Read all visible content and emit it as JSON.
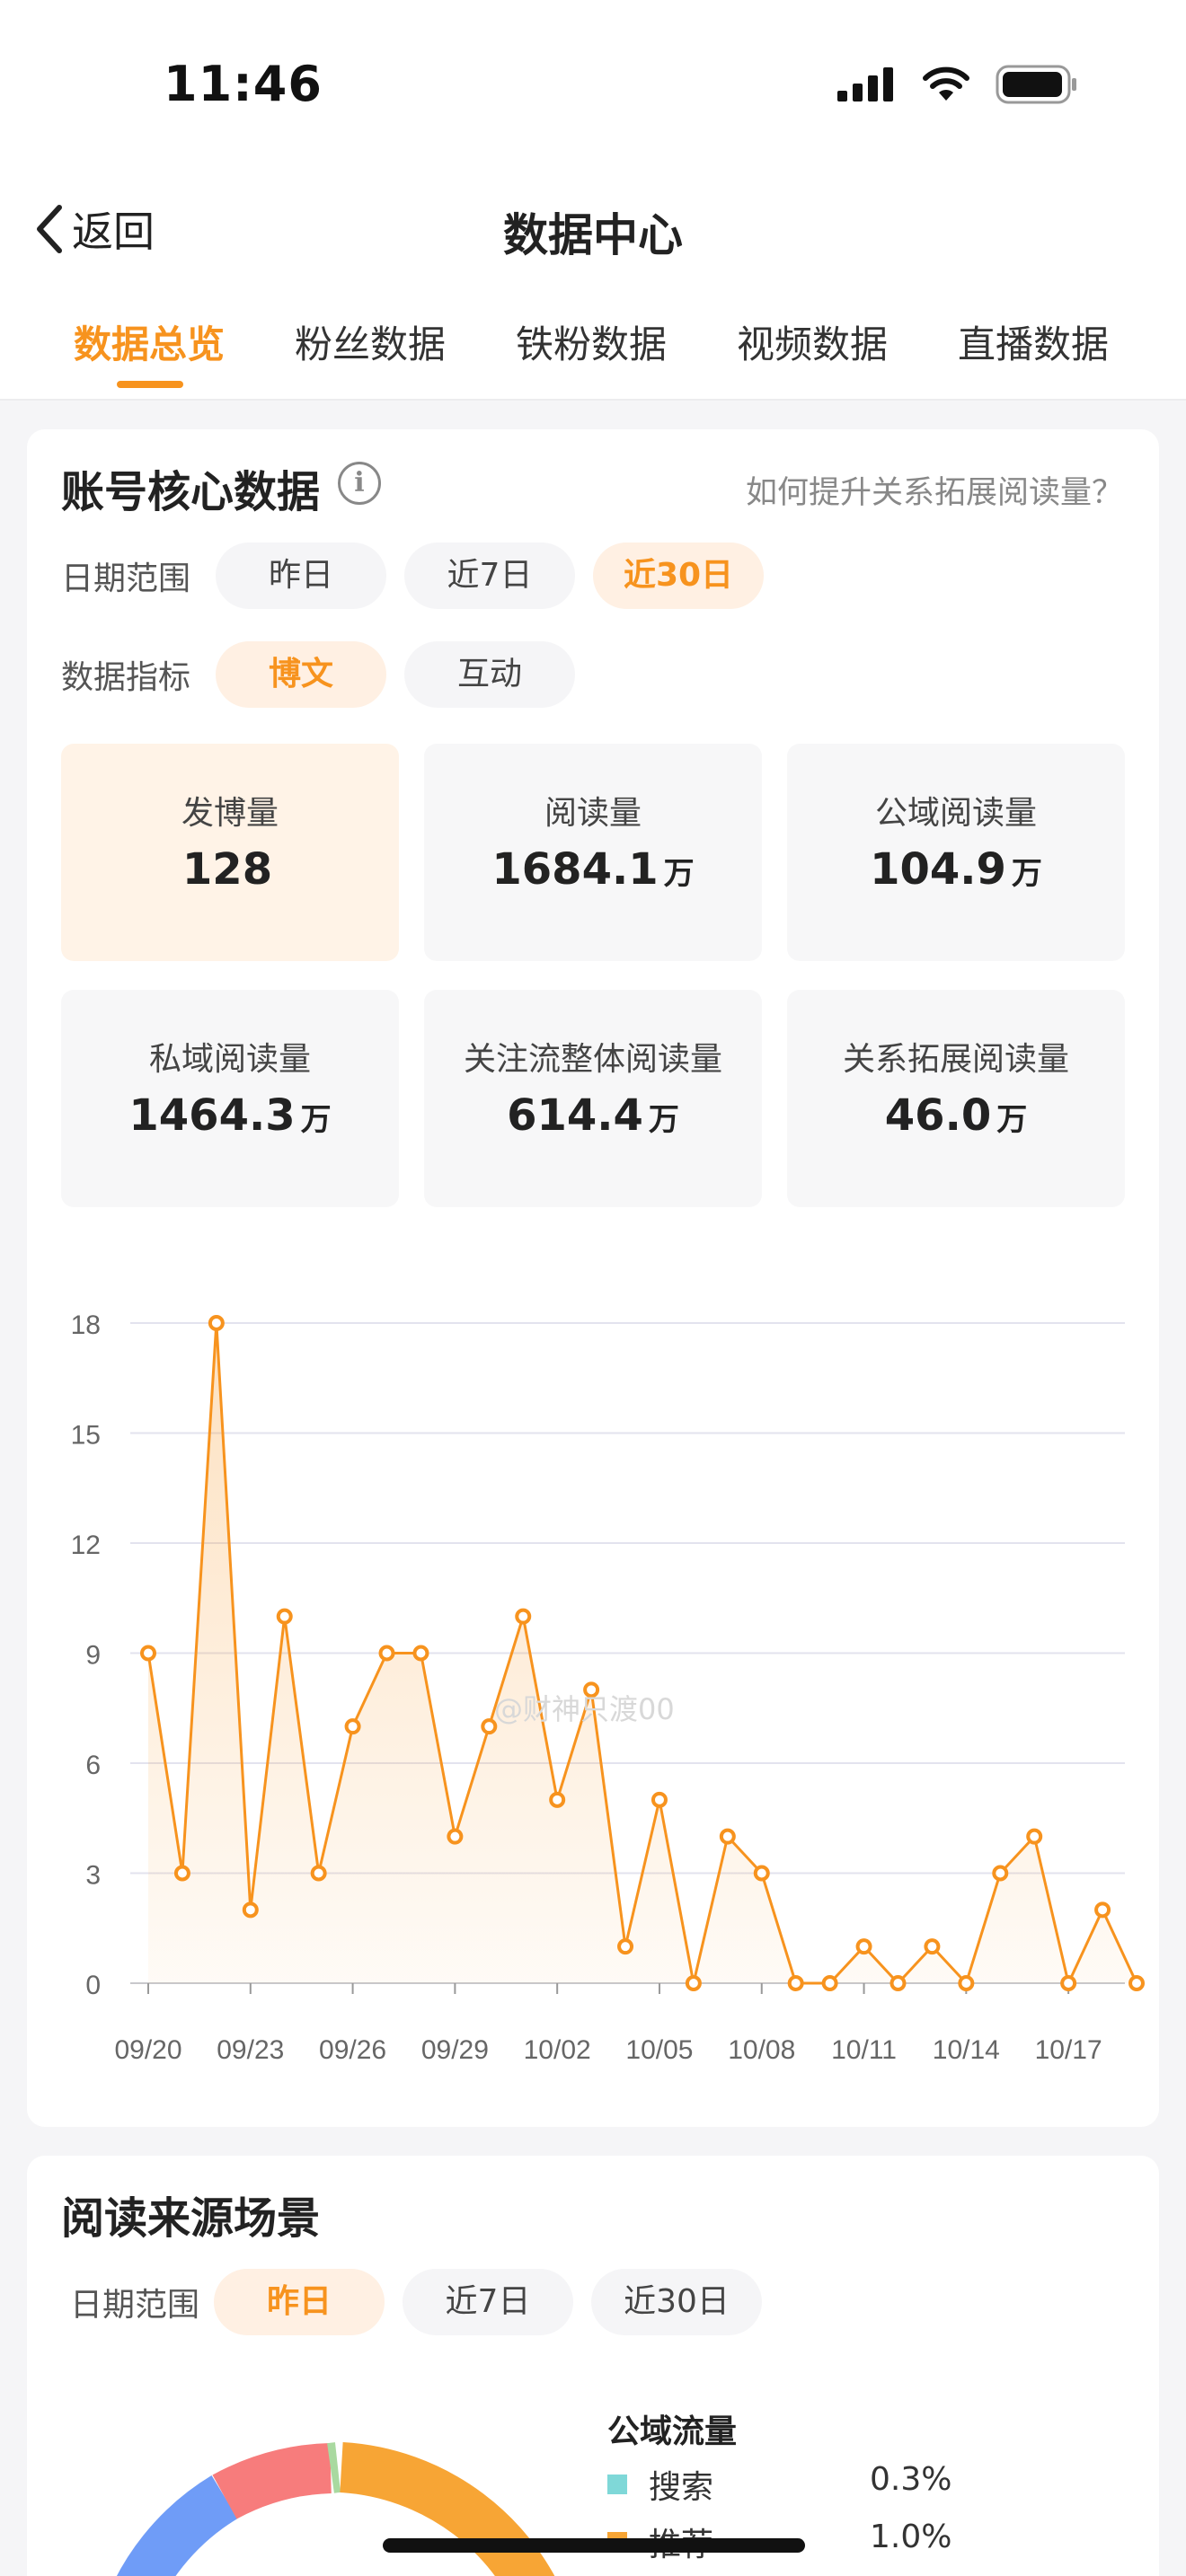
{
  "status": {
    "time": "11:46"
  },
  "nav": {
    "back_label": "返回",
    "title": "数据中心"
  },
  "tabs": [
    "数据总览",
    "粉丝数据",
    "铁粉数据",
    "视频数据",
    "直播数据"
  ],
  "core": {
    "title": "账号核心数据",
    "help_link": "如何提升关系拓展阅读量？",
    "date_label": "日期范围",
    "date_options": [
      "昨日",
      "近7日",
      "近30日"
    ],
    "metric_label": "数据指标",
    "metric_options": [
      "博文",
      "互动"
    ],
    "metrics": [
      {
        "label": "发博量",
        "value": "128",
        "unit": ""
      },
      {
        "label": "阅读量",
        "value": "1684.1",
        "unit": "万"
      },
      {
        "label": "公域阅读量",
        "value": "104.9",
        "unit": "万"
      },
      {
        "label": "私域阅读量",
        "value": "1464.3",
        "unit": "万"
      },
      {
        "label": "关注流整体阅读量",
        "value": "614.4",
        "unit": "万"
      },
      {
        "label": "关系拓展阅读量",
        "value": "46.0",
        "unit": "万"
      }
    ],
    "watermark": "@财神只渡00"
  },
  "chart_data": {
    "type": "area",
    "x": [
      "09/20",
      "09/21",
      "09/22",
      "09/23",
      "09/24",
      "09/25",
      "09/26",
      "09/27",
      "09/28",
      "09/29",
      "09/30",
      "10/01",
      "10/02",
      "10/03",
      "10/04",
      "10/05",
      "10/06",
      "10/07",
      "10/08",
      "10/09",
      "10/10",
      "10/11",
      "10/12",
      "10/13",
      "10/14",
      "10/15",
      "10/16",
      "10/17",
      "10/18",
      "10/19"
    ],
    "values": [
      9,
      3,
      18,
      2,
      10,
      3,
      7,
      9,
      9,
      4,
      7,
      10,
      5,
      8,
      1,
      5,
      0,
      4,
      3,
      0,
      0,
      1,
      0,
      1,
      0,
      3,
      4,
      0,
      2,
      0
    ],
    "xticks": [
      "09/20",
      "09/23",
      "09/26",
      "09/29",
      "10/02",
      "10/05",
      "10/08",
      "10/11",
      "10/14",
      "10/17"
    ],
    "yticks": [
      0,
      3,
      6,
      9,
      12,
      15,
      18
    ],
    "ylim": [
      0,
      18
    ],
    "grid": true,
    "color": "#f7931e"
  },
  "source": {
    "title": "阅读来源场景",
    "date_label": "日期范围",
    "date_options": [
      "昨日",
      "近7日",
      "近30日"
    ],
    "legend_title": "公域流量",
    "legend": [
      {
        "label": "搜索",
        "pct": "0.3%",
        "color": "#7fd8d8"
      },
      {
        "label": "推荐",
        "pct": "1.0%",
        "color": "#f7a535"
      }
    ]
  },
  "colors": {
    "accent": "#f7931e",
    "accent_bg": "#fff0e3"
  }
}
